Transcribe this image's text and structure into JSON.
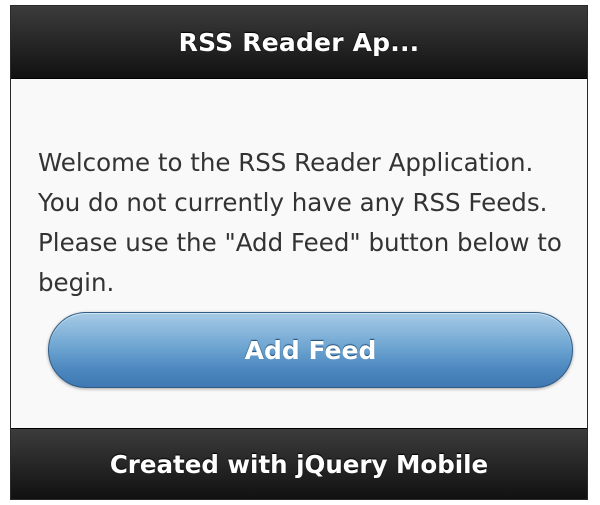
{
  "header": {
    "title": "RSS Reader Ap..."
  },
  "content": {
    "welcome_message": "Welcome to the RSS Reader Application. You do not currently have any RSS Feeds. Please use the \"Add Feed\" button below to begin.",
    "add_feed_label": "Add Feed"
  },
  "footer": {
    "text": "Created with jQuery Mobile"
  },
  "colors": {
    "bar_background": "#1c1c1c",
    "button_blue": "#5b97cb",
    "page_background": "#f9f9f9"
  }
}
